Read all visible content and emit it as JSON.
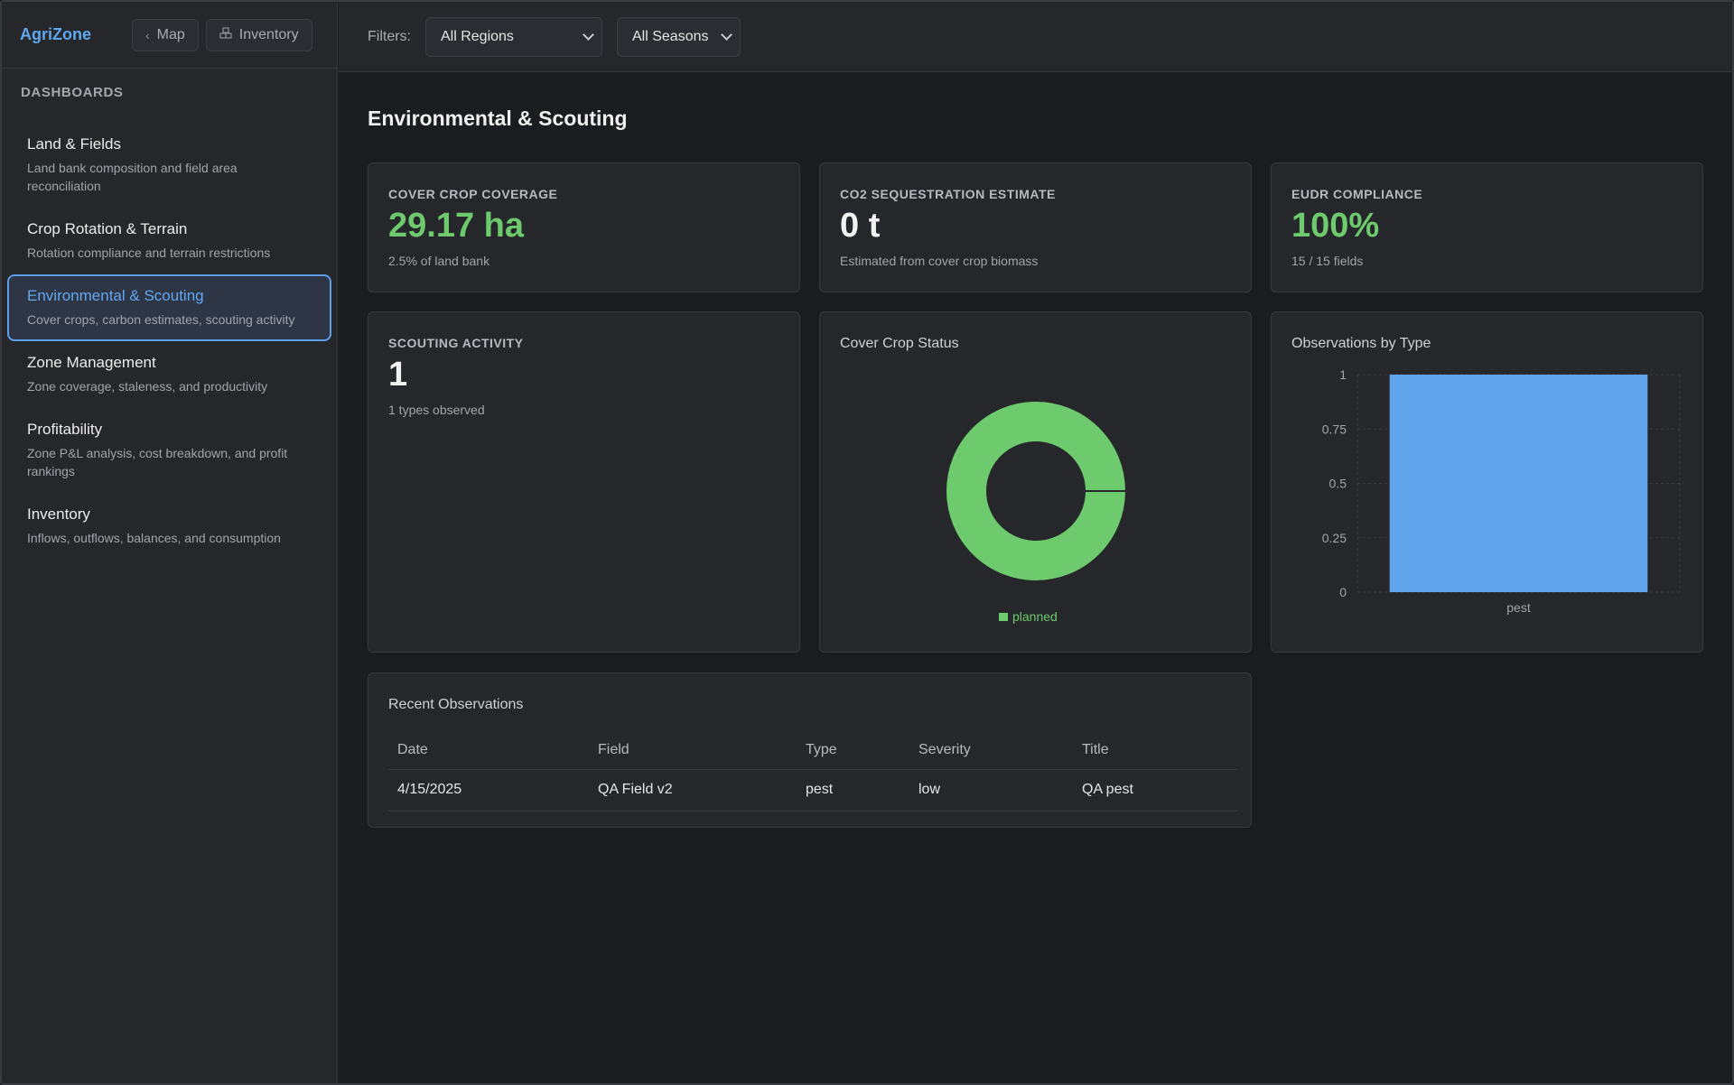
{
  "app": {
    "brand": "AgriZone",
    "map_button": "Map",
    "inventory_button": "Inventory"
  },
  "sidebar": {
    "section_title": "DASHBOARDS",
    "items": [
      {
        "title": "Land & Fields",
        "desc": "Land bank composition and field area reconciliation",
        "active": false
      },
      {
        "title": "Crop Rotation & Terrain",
        "desc": "Rotation compliance and terrain restrictions",
        "active": false
      },
      {
        "title": "Environmental & Scouting",
        "desc": "Cover crops, carbon estimates, scouting activity",
        "active": true
      },
      {
        "title": "Zone Management",
        "desc": "Zone coverage, staleness, and productivity",
        "active": false
      },
      {
        "title": "Profitability",
        "desc": "Zone P&L analysis, cost breakdown, and profit rankings",
        "active": false
      },
      {
        "title": "Inventory",
        "desc": "Inflows, outflows, balances, and consumption",
        "active": false
      }
    ]
  },
  "header": {
    "filters_label": "Filters:",
    "region_select": "All Regions",
    "season_select": "All Seasons"
  },
  "page": {
    "title": "Environmental & Scouting"
  },
  "stats": {
    "cover_crop": {
      "label": "COVER CROP COVERAGE",
      "value": "29.17 ha",
      "sub": "2.5% of land bank"
    },
    "co2": {
      "label": "CO2 SEQUESTRATION ESTIMATE",
      "value": "0 t",
      "sub": "Estimated from cover crop biomass"
    },
    "eudr": {
      "label": "EUDR COMPLIANCE",
      "value": "100%",
      "sub": "15 / 15 fields"
    },
    "scouting": {
      "label": "SCOUTING ACTIVITY",
      "value": "1",
      "sub": "1 types observed"
    }
  },
  "colors": {
    "accent_blue": "#5fa8f0",
    "green": "#6dca6d",
    "bar_blue": "#60a5ec",
    "card_bg": "#26272b"
  },
  "chart_data": [
    {
      "type": "pie",
      "title": "Cover Crop Status",
      "donut": true,
      "categories": [
        "planned"
      ],
      "values": [
        1
      ],
      "colors": [
        "#6dca6d"
      ],
      "legend": "bottom"
    },
    {
      "type": "bar",
      "title": "Observations by Type",
      "categories": [
        "pest"
      ],
      "values": [
        1
      ],
      "ylim": [
        0,
        1
      ],
      "yticks": [
        "0",
        "0.25",
        "0.5",
        "0.75",
        "1"
      ],
      "grid": true,
      "color": "#60a5ec"
    }
  ],
  "observations": {
    "title": "Recent Observations",
    "columns": [
      "Date",
      "Field",
      "Type",
      "Severity",
      "Title"
    ],
    "rows": [
      [
        "4/15/2025",
        "QA Field v2",
        "pest",
        "low",
        "QA pest"
      ]
    ]
  }
}
